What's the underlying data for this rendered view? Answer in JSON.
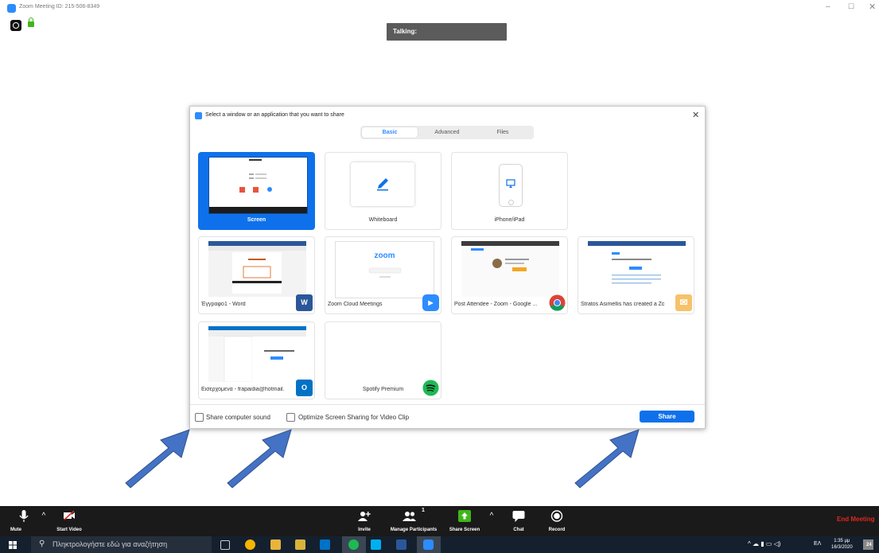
{
  "window": {
    "title": "Zoom Meeting ID: 215-506-8349",
    "minimize_glyph": "–",
    "maximize_glyph": "☐",
    "close_glyph": "✕"
  },
  "talking_indicator": "Talking:",
  "share_dialog": {
    "title": "Select a window or an application that you want to share",
    "close_glyph": "✕",
    "tabs": [
      "Basic",
      "Advanced",
      "Files"
    ],
    "selected_tab": "Basic",
    "tiles": [
      {
        "label": "Screen",
        "selected": true
      },
      {
        "label": "Whiteboard",
        "icon": "pencil-icon"
      },
      {
        "label": "iPhone/iPad",
        "icon": "phone-icon"
      }
    ],
    "apps": [
      {
        "label": "Έγγραφο1 - Word",
        "icon": "word-icon",
        "badge": "W"
      },
      {
        "label": "Zoom Cloud Meetings",
        "icon": "zoom-icon",
        "badge": "▶"
      },
      {
        "label": "Post Attendee - Zoom - Google ...",
        "icon": "chrome-icon",
        "badge": ""
      },
      {
        "label": "Stratos Asimellis has created a Zo...",
        "icon": "mail-icon",
        "badge": "✉"
      },
      {
        "label": "Εισερχόμενα - frapaidia@hotmail....",
        "icon": "outlook-icon",
        "badge": "O"
      },
      {
        "label": "Spotify Premium",
        "icon": "spotify-icon",
        "badge": ""
      }
    ],
    "zoom_thumb_text": "zoom",
    "options": {
      "share_sound_label": "Share computer sound",
      "optimize_label": "Optimize Screen Sharing for Video Clip"
    },
    "share_button": "Share"
  },
  "toolbar": {
    "mute": "Mute",
    "start_video": "Start Video",
    "invite": "Invite",
    "manage_participants": "Manage Participants",
    "participant_count": "1",
    "share_screen": "Share Screen",
    "chat": "Chat",
    "record": "Record",
    "end_meeting": "End Meeting"
  },
  "taskbar": {
    "search_placeholder": "Πληκτρολογήστε εδώ για αναζήτηση",
    "language": "ΕΛ",
    "time": "1:35 μμ",
    "date": "16/3/2020",
    "notification_count": "24"
  },
  "colors": {
    "accent": "#0e71eb",
    "zoom_blue": "#2D8CFF",
    "arrow_fill": "#4472C4",
    "end_meeting": "#e0281e"
  }
}
